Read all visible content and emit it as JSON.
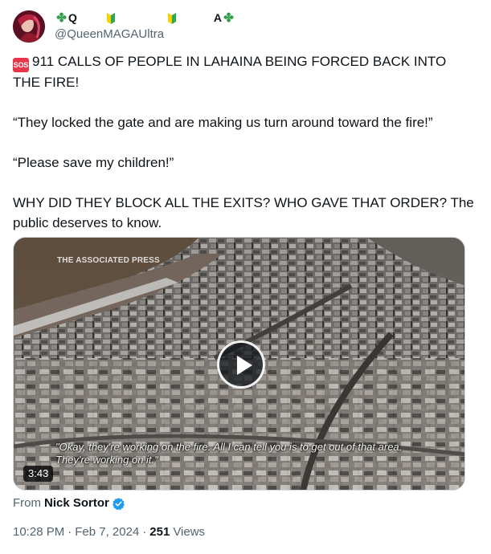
{
  "author": {
    "name_parts": [
      "Q",
      "A"
    ],
    "handle": "@QueenMAGAUltra",
    "icons": [
      "four-leaf-clover-icon",
      "japanese-beginner-symbol-icon",
      "japanese-beginner-symbol-icon",
      "four-leaf-clover-icon"
    ]
  },
  "tweet": {
    "sos_badge": "SOS",
    "line1": "911 CALLS OF PEOPLE IN LAHAINA BEING FORCED BACK INTO THE FIRE!",
    "line2": "“They locked the gate and are making us turn around toward the fire!”",
    "line3": "“Please save my children!”",
    "line4": "WHY DID THEY BLOCK ALL THE EXITS? WHO GAVE THAT ORDER? The public deserves to know."
  },
  "video": {
    "watermark": "THE ASSOCIATED PRESS",
    "caption_line1": "\"Okay, they're working on the fire. All I can tell you is to get out of that area.",
    "caption_line2": "They're working on it.\"",
    "duration": "3:43"
  },
  "source": {
    "prefix": "From",
    "author": "Nick Sortor"
  },
  "meta": {
    "time": "10:28 PM",
    "date": "Feb 7, 2024",
    "views_count": "251",
    "views_label": "Views"
  },
  "colors": {
    "text": "#0f1419",
    "secondary": "#536471",
    "verified": "#1d9bf0",
    "sos": "#e8354a"
  }
}
